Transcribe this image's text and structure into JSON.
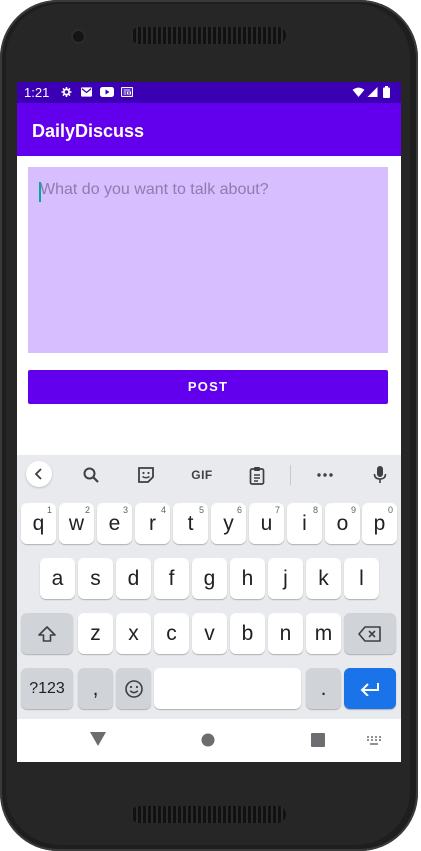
{
  "status_bar": {
    "time": "1:21"
  },
  "app_bar": {
    "title": "DailyDiscuss"
  },
  "compose": {
    "placeholder": "What do you want to talk about?"
  },
  "post_button": {
    "label": "POST"
  },
  "keyboard": {
    "toolbar": {
      "gif_label": "GIF"
    },
    "row1": [
      {
        "label": "q",
        "hint": "1"
      },
      {
        "label": "w",
        "hint": "2"
      },
      {
        "label": "e",
        "hint": "3"
      },
      {
        "label": "r",
        "hint": "4"
      },
      {
        "label": "t",
        "hint": "5"
      },
      {
        "label": "y",
        "hint": "6"
      },
      {
        "label": "u",
        "hint": "7"
      },
      {
        "label": "i",
        "hint": "8"
      },
      {
        "label": "o",
        "hint": "9"
      },
      {
        "label": "p",
        "hint": "0"
      }
    ],
    "row2": [
      "a",
      "s",
      "d",
      "f",
      "g",
      "h",
      "j",
      "k",
      "l"
    ],
    "row3": [
      "z",
      "x",
      "c",
      "v",
      "b",
      "n",
      "m"
    ],
    "symbols_label": "?123",
    "comma_label": ",",
    "period_label": "."
  },
  "colors": {
    "status_bar": "#3b00b3",
    "primary": "#6200ee",
    "compose_bg": "#d7bfff",
    "enter_key": "#1a73e8"
  }
}
